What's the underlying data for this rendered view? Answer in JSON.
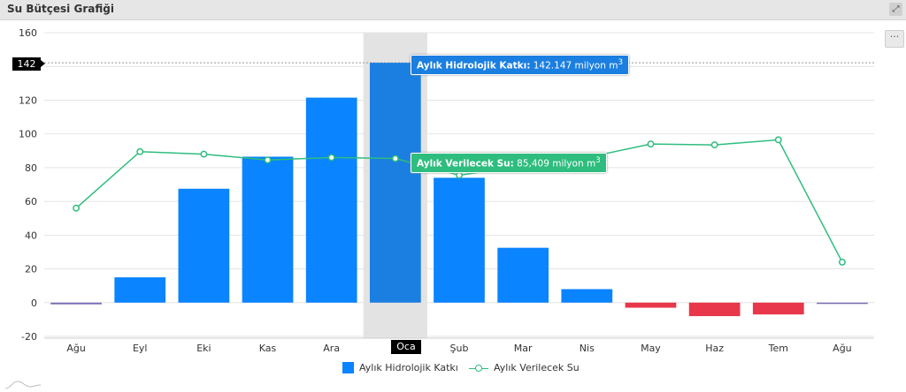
{
  "window": {
    "title": "Su Bütçesi Grafiği",
    "expand_icon": "expand-icon"
  },
  "menu": {
    "label": "···",
    "icon": "more-icon"
  },
  "crosshair": {
    "y_label": "142",
    "x_label": "Oca"
  },
  "tooltips": {
    "bar": {
      "series": "Aylık Hidrolojik Katkı:",
      "value": "142.147 milyon m",
      "unit_sup": "3"
    },
    "line": {
      "series": "Aylık Verilecek Su:",
      "value": "85,409 milyon m",
      "unit_sup": "3"
    }
  },
  "legend": {
    "bar_label": "Aylık Hidrolojik Katkı",
    "line_label": "Aylık Verilecek Su"
  },
  "colors": {
    "bar_positive": "#0a84ff",
    "bar_highlight": "#1a7fe0",
    "bar_negative": "#e8364a",
    "line": "#2ebd7e",
    "highlight_band": "#e3e3e3"
  },
  "chart_data": {
    "type": "bar",
    "categories": [
      "Ağu",
      "Eyl",
      "Eki",
      "Kas",
      "Ara",
      "Oca",
      "Şub",
      "Mar",
      "Nis",
      "May",
      "Haz",
      "Tem",
      "Ağu"
    ],
    "x_tick_labels": [
      "Ağu",
      "Eyl",
      "Eki",
      "Kas",
      "Ara",
      "O",
      "Şub",
      "Mar",
      "Nis",
      "May",
      "Haz",
      "Tem",
      "Ağu"
    ],
    "x_tick_partial": "2",
    "series": [
      {
        "name": "Aylık Hidrolojik Katkı",
        "type": "bar",
        "values": [
          -1,
          15,
          67.5,
          86.5,
          121.5,
          142.147,
          74,
          32.5,
          8,
          -3,
          -8,
          -7,
          -0.5
        ]
      },
      {
        "name": "Aylık Verilecek Su",
        "type": "line",
        "values": [
          56,
          89.5,
          88,
          84.5,
          86,
          85.409,
          75.5,
          81,
          86,
          94,
          93.5,
          96.5,
          24
        ]
      }
    ],
    "highlighted_category_index": 5,
    "ylim": [
      -20,
      160
    ],
    "yticks": [
      -20,
      0,
      20,
      40,
      60,
      80,
      100,
      120,
      140,
      160
    ],
    "grid": true,
    "legend_position": "bottom-center"
  }
}
